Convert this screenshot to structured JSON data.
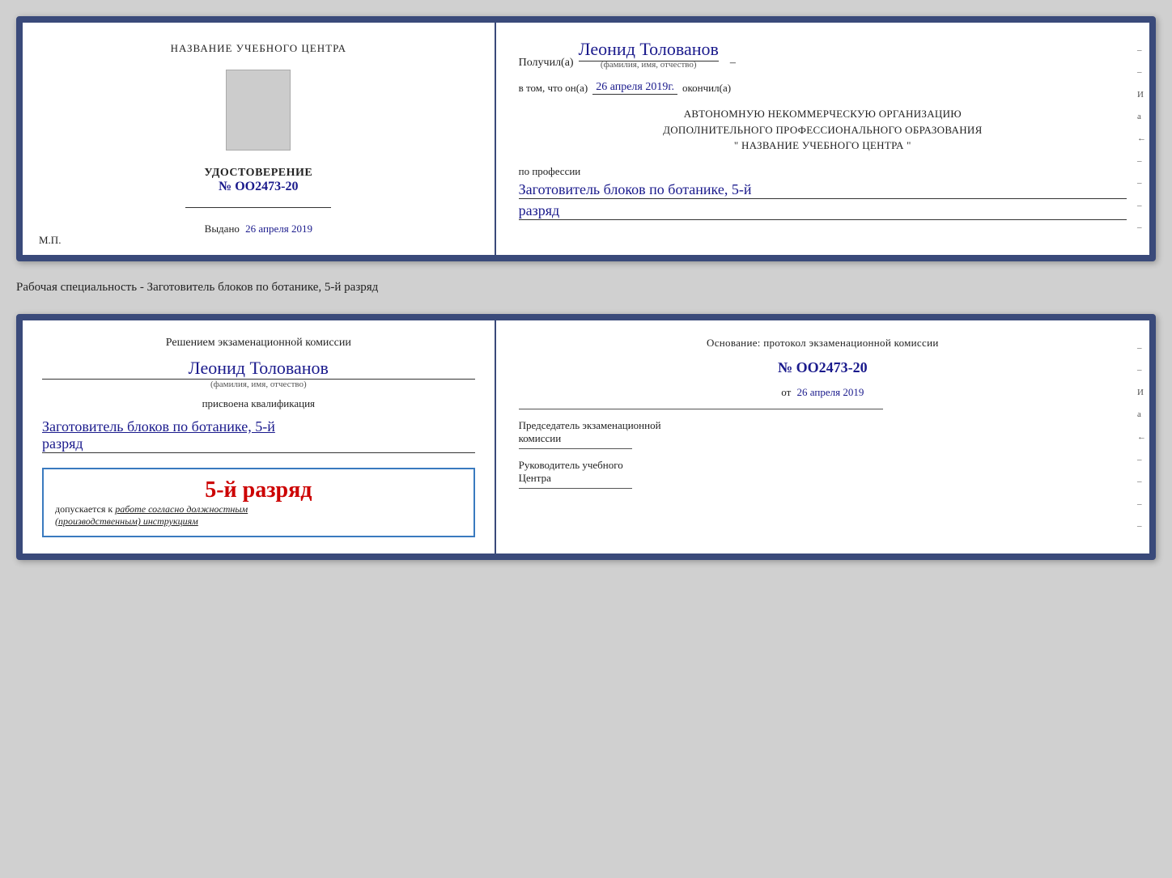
{
  "top_doc": {
    "left": {
      "training_center_label": "НАЗВАНИЕ УЧЕБНОГО ЦЕНТРА",
      "udostoverenie_label": "УДОСТОВЕРЕНИЕ",
      "number": "№ OO2473-20",
      "vydano_label": "Выдано",
      "vydano_date": "26 апреля 2019",
      "mp_label": "М.П."
    },
    "right": {
      "poluchil_label": "Получил(а)",
      "name": "Леонид Толованов",
      "fio_subtitle": "(фамилия, имя, отчество)",
      "vtom_label": "в том, что он(а)",
      "date_value": "26 апреля 2019г.",
      "okonchil_label": "окончил(а)",
      "avtonomnuyu_line1": "АВТОНОМНУЮ НЕКОММЕРЧЕСКУЮ ОРГАНИЗАЦИЮ",
      "avtonomnuyu_line2": "ДОПОЛНИТЕЛЬНОГО ПРОФЕССИОНАЛЬНОГО ОБРАЗОВАНИЯ",
      "center_name": "\"   НАЗВАНИЕ УЧЕБНОГО ЦЕНТРА   \"",
      "po_professii_label": "по профессии",
      "profession": "Заготовитель блоков по ботанике, 5-й",
      "razryad": "разряд"
    }
  },
  "separator": {
    "text": "Рабочая специальность - Заготовитель блоков по ботанике, 5-й разряд"
  },
  "bottom_doc": {
    "left": {
      "resheniem_label": "Решением экзаменационной комиссии",
      "name": "Леонид Толованов",
      "fio_subtitle": "(фамилия, имя, отчество)",
      "prisvoena_label": "присвоена квалификация",
      "qualification": "Заготовитель блоков по ботанике, 5-й",
      "razryad": "разряд",
      "stamp_rank": "5-й разряд",
      "dopuskaetsya_label": "допускается к",
      "dopuskaetsya_value": "работе согласно должностным",
      "instruktsiyam": "(производственным) инструкциям"
    },
    "right": {
      "osnovanie_label": "Основание: протокол экзаменационной комиссии",
      "number": "№  OO2473-20",
      "ot_label": "от",
      "ot_date": "26 апреля 2019",
      "predsedatel_label": "Председатель экзаменационной",
      "komissii_label": "комиссии",
      "rukovoditel_label": "Руководитель учебного",
      "tsentra_label": "Центра"
    }
  },
  "side_marks": [
    "–",
    "–",
    "И",
    "а",
    "←",
    "–",
    "–",
    "–",
    "–"
  ]
}
